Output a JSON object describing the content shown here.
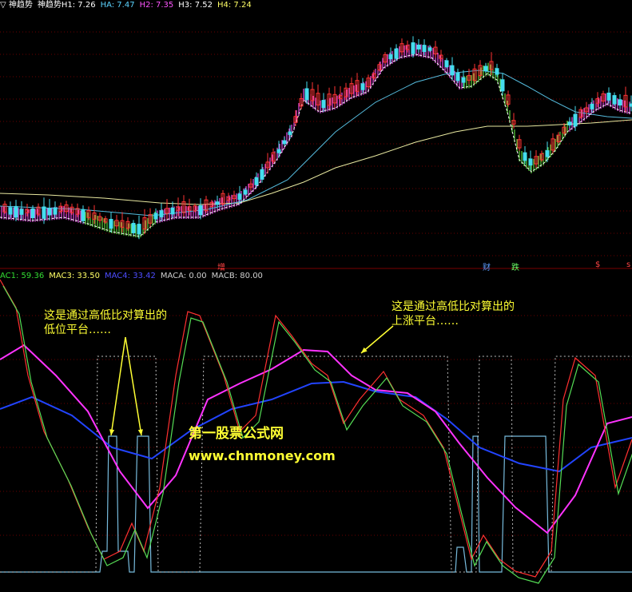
{
  "header_top": {
    "indicator": "▽ 神趋势",
    "items": [
      {
        "label": "神趋势H1:",
        "value": "7.26",
        "color": "#ffffff"
      },
      {
        "label": "HA:",
        "value": "7.47",
        "color": "#5bd3ff"
      },
      {
        "label": "H2:",
        "value": "7.35",
        "color": "#ff55ff"
      },
      {
        "label": "H3:",
        "value": "7.52",
        "color": "#ffffff"
      },
      {
        "label": "H4:",
        "value": "7.24",
        "color": "#ffff66"
      }
    ]
  },
  "header_bottom": {
    "items": [
      {
        "label": "AC1:",
        "value": "59.36",
        "color": "#33dd33"
      },
      {
        "label": "MAC3:",
        "value": "33.50",
        "color": "#ffff66"
      },
      {
        "label": "MAC4:",
        "value": "33.42",
        "color": "#4d4dff"
      },
      {
        "label": "MACA:",
        "value": "0.00",
        "color": "#cfcfcf"
      },
      {
        "label": "MACB:",
        "value": "80.00",
        "color": "#cfcfcf"
      }
    ]
  },
  "markers": [
    {
      "text": "增",
      "color": "#ff4444"
    },
    {
      "text": "财",
      "color": "#5b9cff"
    },
    {
      "text": "跌",
      "color": "#66ff66"
    },
    {
      "text": "$",
      "color": "#ff4444"
    },
    {
      "text": "s",
      "color": "#ff4444"
    }
  ],
  "annotations": {
    "left_line1": "这是通过高低比对算出的",
    "left_line2": "低位平台……",
    "right_line1": "这是通过高低比对算出的",
    "right_line2": "上涨平台……"
  },
  "watermark": {
    "name": "第一股票公式网",
    "url": "www.chnmoney.com"
  },
  "colors": {
    "background": "#000000",
    "up_candle": "#ff3333",
    "down_candle": "#44ddee",
    "bull_fill": "#ff55ff",
    "bear_fill": "#66ee44",
    "ma_fast": "#ffffff",
    "ma_mid": "#55bbdd",
    "ma_slow": "#e8e8a0",
    "osc_red": "#ff3030",
    "osc_green": "#55dd55",
    "osc_magenta": "#ff33ff",
    "osc_blue": "#2244ff",
    "osc_platform": "#77bbdd",
    "annotation": "#ffff33"
  },
  "chart_data": [
    {
      "type": "candlestick",
      "title": "神趋势",
      "ylim": [
        6.8,
        7.7
      ],
      "grid": true,
      "series": [
        {
          "name": "H1",
          "last": 7.26
        },
        {
          "name": "HA",
          "last": 7.47
        },
        {
          "name": "H2",
          "last": 7.35
        },
        {
          "name": "H3",
          "last": 7.52
        },
        {
          "name": "H4",
          "last": 7.24
        }
      ]
    },
    {
      "type": "line",
      "ylim": [
        0,
        100
      ],
      "grid": true,
      "series": [
        {
          "name": "AC1",
          "last": 59.36
        },
        {
          "name": "MAC3",
          "last": 33.5
        },
        {
          "name": "MAC4",
          "last": 33.42
        },
        {
          "name": "MACA",
          "last": 0.0
        },
        {
          "name": "MACB",
          "last": 80.0
        }
      ]
    }
  ]
}
